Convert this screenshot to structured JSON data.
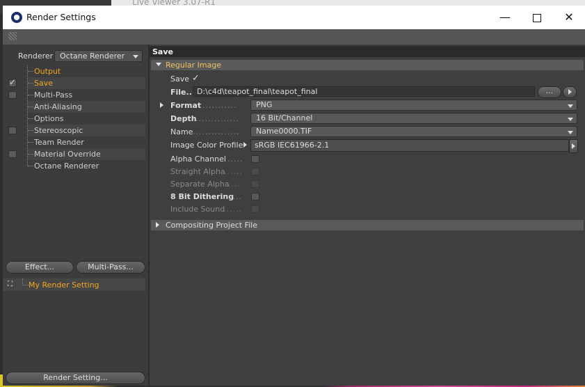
{
  "background": {
    "other_window_title": "Live Viewer 3.07-R1"
  },
  "window": {
    "title": "Render Settings"
  },
  "sidebar": {
    "renderer_label": "Renderer",
    "renderer_value": "Octane Renderer",
    "items": [
      {
        "label": "Output",
        "checkbox": false,
        "checked": false
      },
      {
        "label": "Save",
        "checkbox": true,
        "checked": true
      },
      {
        "label": "Multi-Pass",
        "checkbox": true,
        "checked": false
      },
      {
        "label": "Anti-Aliasing",
        "checkbox": false,
        "checked": false
      },
      {
        "label": "Options",
        "checkbox": false,
        "checked": false
      },
      {
        "label": "Stereoscopic",
        "checkbox": true,
        "checked": false
      },
      {
        "label": "Team Render",
        "checkbox": false,
        "checked": false
      },
      {
        "label": "Material Override",
        "checkbox": true,
        "checked": false
      },
      {
        "label": "Octane Renderer",
        "checkbox": false,
        "checked": false
      }
    ],
    "effect_button": "Effect...",
    "multipass_button": "Multi-Pass...",
    "render_setting_name": "My Render Setting",
    "render_setting_button": "Render Setting..."
  },
  "panel": {
    "title": "Save",
    "regular_image": {
      "header": "Regular Image",
      "save_label": "Save",
      "save_checked": true,
      "file_label": "File...",
      "file_path": "D:\\c4d\\teapot_final\\teapot_final",
      "browse_button": "...",
      "format_label": "Format",
      "format_value": "PNG",
      "depth_label": "Depth",
      "depth_value": "16 Bit/Channel",
      "name_label": "Name",
      "name_value": "Name0000.TIF",
      "color_profile_label": "Image Color Profile",
      "color_profile_value": "sRGB IEC61966-2.1",
      "alpha_channel_label": "Alpha Channel",
      "straight_alpha_label": "Straight Alpha",
      "separate_alpha_label": "Separate Alpha",
      "dithering_label": "8 Bit Dithering",
      "include_sound_label": "Include Sound"
    },
    "compositing_header": "Compositing Project File"
  },
  "colors": {
    "accent": "#f5a623",
    "panel_bg": "#404040",
    "section_bg": "#5a5a5a"
  }
}
